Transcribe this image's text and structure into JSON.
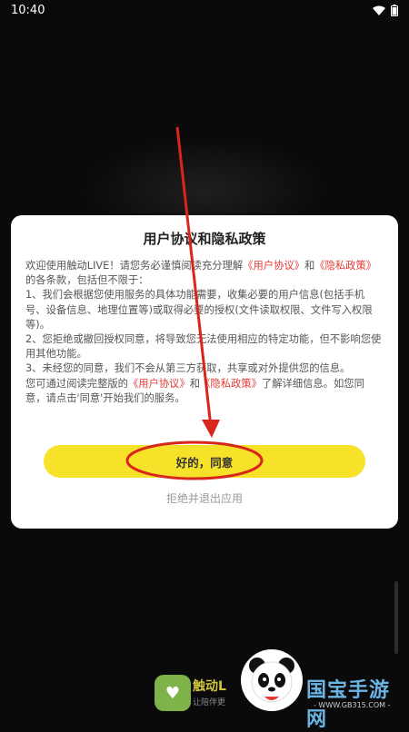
{
  "status": {
    "time": "10:40"
  },
  "dialog": {
    "title": "用户协议和隐私政策",
    "body": [
      [
        {
          "t": "欢迎使用触动LIVE！请您务必谨慎阅读充分理解"
        },
        {
          "t": "《用户协议》",
          "link": true
        },
        {
          "t": "和"
        },
        {
          "t": "《隐私政策》",
          "link": true
        },
        {
          "t": "的各条款，包括但不限于："
        }
      ],
      [
        {
          "t": "1、我们会根据您使用服务的具体功能需要，收集必要的用户信息(包括手机号、设备信息、地理位置等)或取得必要的授权(文件读取权限、文件写入权限等)。"
        }
      ],
      [
        {
          "t": "2、您拒绝或撤回授权同意，将导致您无法使用相应的特定功能，但不影响您使用其他功能。"
        }
      ],
      [
        {
          "t": "3、未经您的同意，我们不会从第三方获取，共享或对外提供您的信息。"
        }
      ],
      [
        {
          "t": "您可通过阅读完整版的"
        },
        {
          "t": "《用户协议》",
          "link": true
        },
        {
          "t": "和"
        },
        {
          "t": "《隐私政策》",
          "link": true
        },
        {
          "t": "了解详细信息。如您同意，请点击'同意'开始我们的服务。"
        }
      ]
    ],
    "agree_label": "好的，同意",
    "reject_label": "拒绝并退出应用"
  },
  "background_app": {
    "name": "触动L",
    "slogan": "让陪伴更",
    "accent": "#d2c43c"
  },
  "watermark": {
    "title": "国宝手游网",
    "url": "- WWW.GB315.COM -"
  },
  "colors": {
    "link": "#e53935",
    "agree": "#f7e22a",
    "annotation": "#d9261c"
  }
}
